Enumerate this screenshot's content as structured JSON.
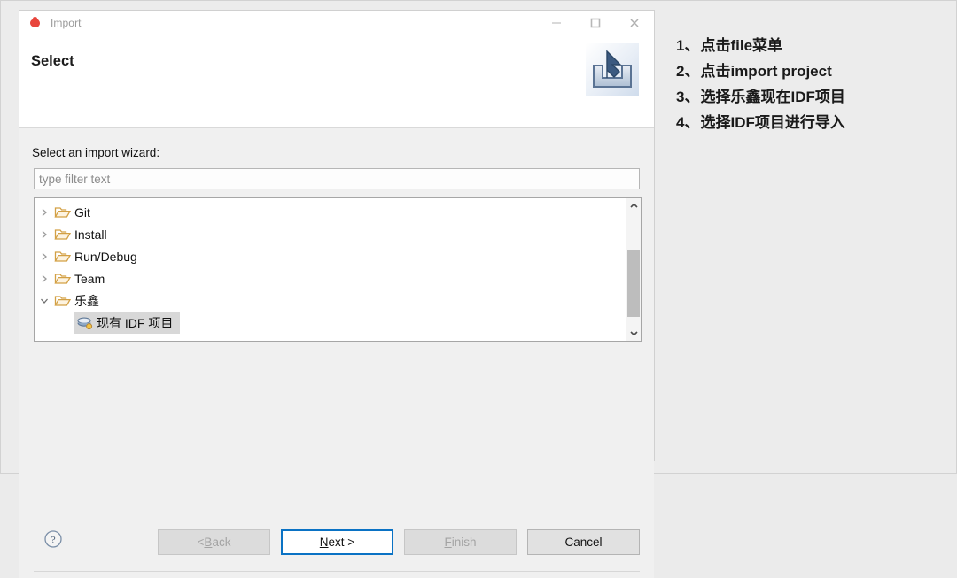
{
  "dialog": {
    "titlebar": {
      "app_icon": "eclipse-red-sphere-icon",
      "title": "Import",
      "minimize_label": "minimize-icon",
      "maximize_label": "maximize-icon",
      "close_label": "close-icon"
    },
    "header": {
      "title": "Select",
      "icon": "import-tray-arrow-icon"
    },
    "form": {
      "wizard_label_mnemonic": "S",
      "wizard_label_rest": "elect an import wizard:",
      "filter_placeholder": "type filter text",
      "filter_value": ""
    },
    "tree": {
      "items": [
        {
          "label": "Git",
          "expanded": false,
          "icon": "folder-icon",
          "selected": false,
          "level": 0
        },
        {
          "label": "Install",
          "expanded": false,
          "icon": "folder-icon",
          "selected": false,
          "level": 0
        },
        {
          "label": "Run/Debug",
          "expanded": false,
          "icon": "folder-icon",
          "selected": false,
          "level": 0
        },
        {
          "label": "Team",
          "expanded": false,
          "icon": "folder-icon",
          "selected": false,
          "level": 0
        },
        {
          "label": "乐鑫",
          "expanded": true,
          "icon": "folder-icon",
          "selected": false,
          "level": 0
        },
        {
          "label": "现有 IDF 项目",
          "expanded": null,
          "icon": "idf-project-icon",
          "selected": true,
          "level": 1
        }
      ],
      "selection_color": "#d8d8d8",
      "folder_color": "#d3a044"
    },
    "footer": {
      "help_icon": "help-question-icon",
      "buttons": [
        {
          "label_pre": "< ",
          "mnemonic": "B",
          "label_post": "ack",
          "state": "disabled",
          "name": "back-button"
        },
        {
          "label_pre": "",
          "mnemonic": "N",
          "label_post": "ext >",
          "state": "focused",
          "name": "next-button"
        },
        {
          "label_pre": "",
          "mnemonic": "F",
          "label_post": "inish",
          "state": "disabled",
          "name": "finish-button"
        },
        {
          "label_pre": "",
          "mnemonic": "",
          "label_post": "Cancel",
          "state": "enabled",
          "name": "cancel-button"
        }
      ],
      "focus_color": "#0a72c4"
    }
  },
  "annotations": [
    {
      "num": "1、",
      "text": "点击file菜单"
    },
    {
      "num": "2、",
      "text": "点击import project"
    },
    {
      "num": "3、",
      "text": "选择乐鑫现在IDF项目"
    },
    {
      "num": "4、",
      "text": "选择IDF项目进行导入"
    }
  ]
}
